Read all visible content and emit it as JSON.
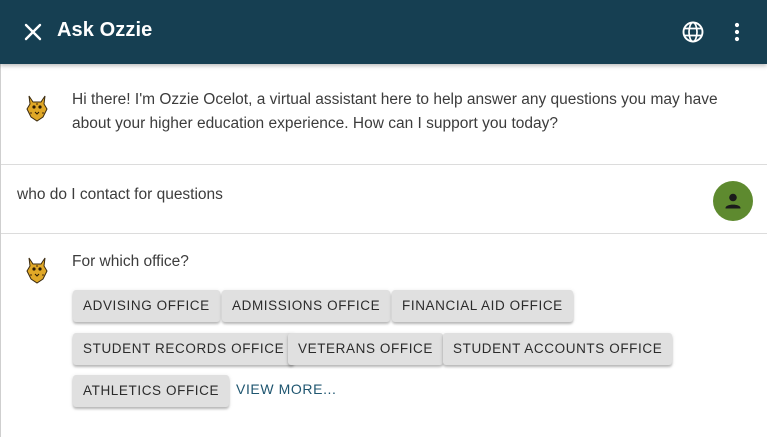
{
  "header": {
    "title": "Ask Ozzie",
    "background_color": "#163f52",
    "close_icon": "close-icon",
    "language_icon": "globe-icon",
    "menu_icon": "more-vertical-icon"
  },
  "messages": {
    "greeting": "Hi there! I'm Ozzie Ocelot, a virtual assistant here to help answer any questions you may have about your higher education experience. How can I support you today?",
    "user_message": "who do I contact for questions",
    "bot_question": "For which office?"
  },
  "options": {
    "chips": [
      "ADVISING OFFICE",
      "ADMISSIONS OFFICE",
      "FINANCIAL AID OFFICE",
      "STUDENT RECORDS OFFICE",
      "VETERANS OFFICE",
      "STUDENT ACCOUNTS OFFICE",
      "ATHLETICS OFFICE"
    ],
    "view_more": "VIEW MORE..."
  },
  "colors": {
    "user_avatar": "#5e8a2f",
    "chip_background": "#e0e0e0",
    "link": "#1f5670"
  }
}
